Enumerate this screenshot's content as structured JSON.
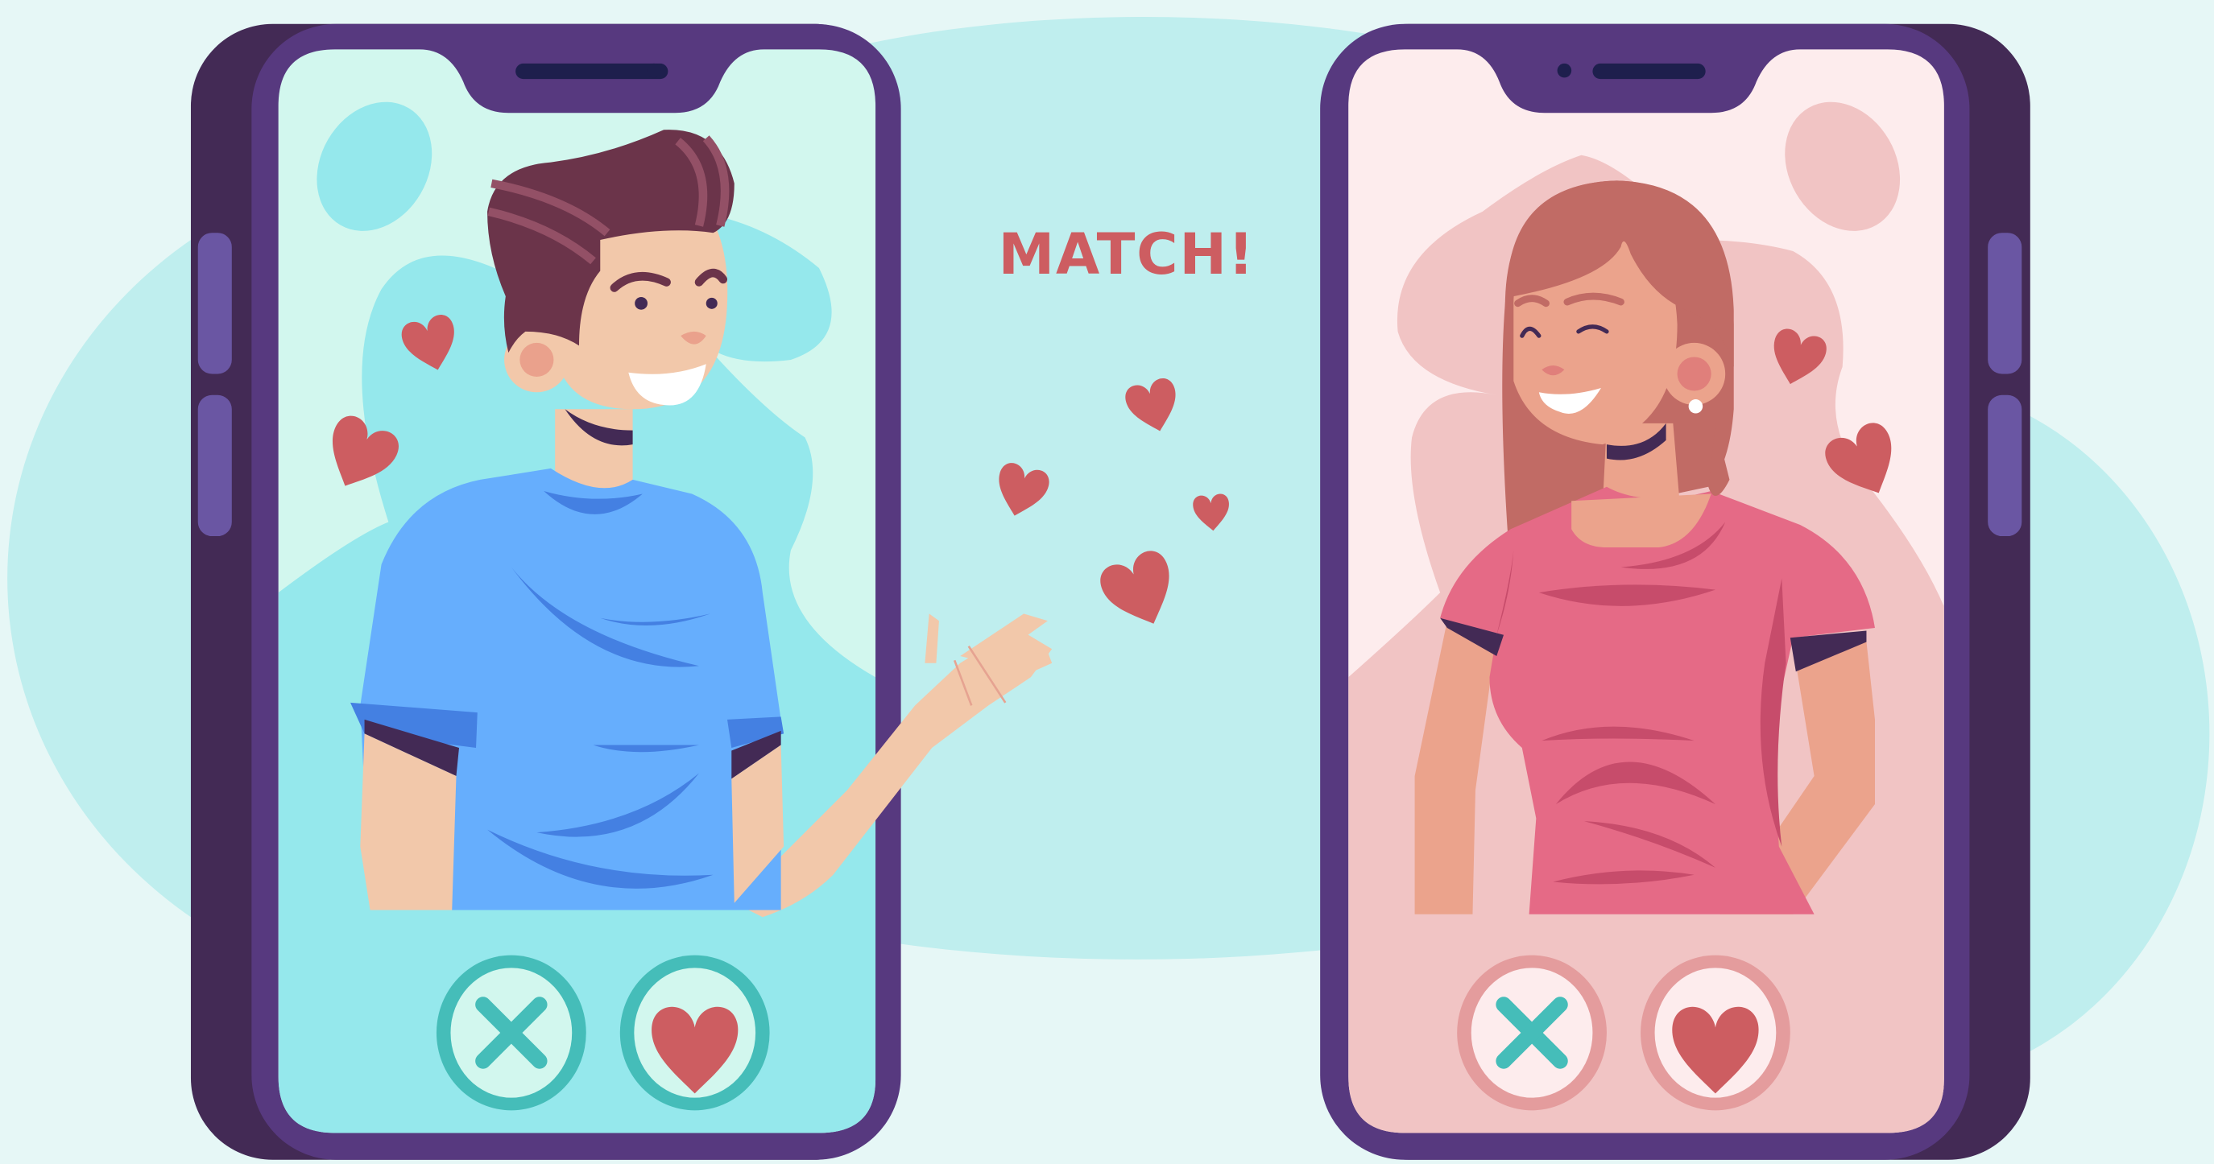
{
  "match_banner": {
    "text": "MATCH!"
  },
  "colors": {
    "background": "#e6f7f6",
    "blob": "#bfeeee",
    "phone_body": "#57397f",
    "phone_side": "#432a55",
    "phone_button": "#6a56a3",
    "screen_left": "#95e8ec",
    "screen_left_light": "#d2f7ee",
    "screen_right": "#f1c4c4",
    "screen_right_light": "#fdeced",
    "heart": "#cd5d61",
    "match_text": "#cd5d61",
    "accept_ring": "#45bdb9",
    "reject_ring_pink": "#e49c9d"
  },
  "left_phone": {
    "reject_button": {
      "icon": "close-icon"
    },
    "like_button": {
      "icon": "heart-icon"
    }
  },
  "right_phone": {
    "reject_button": {
      "icon": "close-icon"
    },
    "like_button": {
      "icon": "heart-icon"
    }
  }
}
